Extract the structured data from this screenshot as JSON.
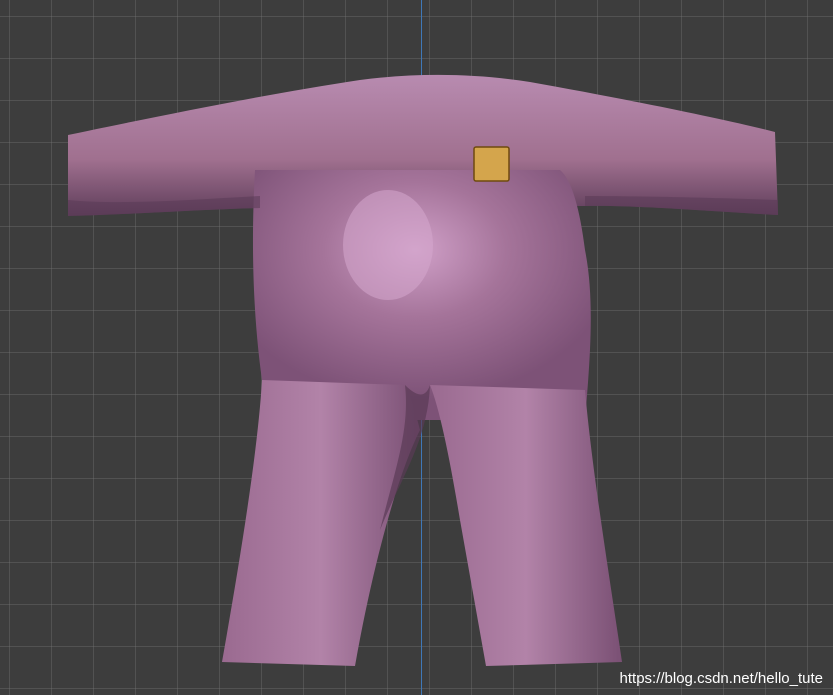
{
  "viewport": {
    "background_color": "#3d3d3d",
    "grid_color": "#555555",
    "axis_color": "#3f78b8"
  },
  "mesh": {
    "body_color": "#a5749a",
    "highlight_color": "#d0a0c8",
    "shadow_color": "#6a4664"
  },
  "selection_marker": {
    "fill_color": "#d4a54c",
    "border_color": "#6e4a0f"
  },
  "watermark": {
    "text": "https://blog.csdn.net/hello_tute"
  }
}
